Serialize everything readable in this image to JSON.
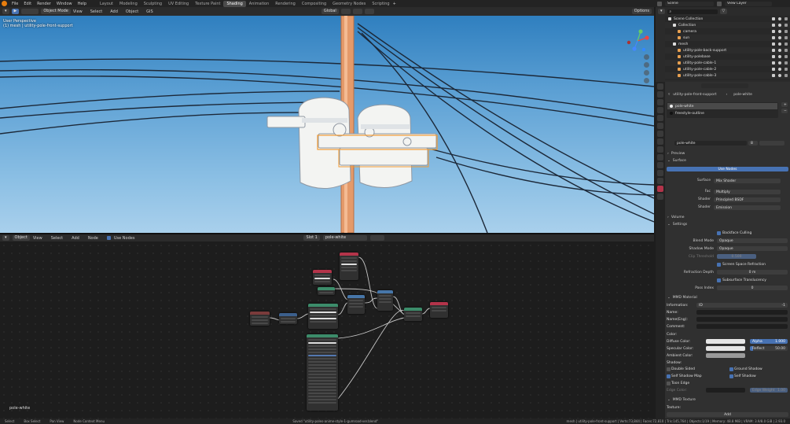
{
  "menu": {
    "items": [
      "File",
      "Edit",
      "Render",
      "Window",
      "Help"
    ]
  },
  "workspaces": [
    "Layout",
    "Modeling",
    "Sculpting",
    "UV Editing",
    "Texture Paint",
    "Shading",
    "Animation",
    "Rendering",
    "Compositing",
    "Geometry Nodes",
    "Scripting"
  ],
  "scene": {
    "name": "Scene",
    "view_layer": "View Layer"
  },
  "viewport": {
    "mode": "Object Mode",
    "menus": [
      "View",
      "Select",
      "Add",
      "Object",
      "GIS"
    ],
    "orientation": "Global",
    "options": "Options",
    "info_line1": "User Perspective",
    "info_line2": "(1) mesh | utility-pole-front-support"
  },
  "node_editor": {
    "type": "Object",
    "menus": [
      "View",
      "Select",
      "Add",
      "Node"
    ],
    "use_nodes": "Use Nodes",
    "slot": "Slot 1",
    "material": "pole-white",
    "footer_label": "pole-white"
  },
  "outliner": {
    "rows": [
      {
        "label": "Scene Collection",
        "indent": 0
      },
      {
        "label": "Collection",
        "indent": 1
      },
      {
        "label": "camera",
        "indent": 2
      },
      {
        "label": "sun",
        "indent": 2
      },
      {
        "label": "mesh",
        "indent": 1
      },
      {
        "label": "utility-pole-back-support",
        "indent": 2
      },
      {
        "label": "utility-polebase",
        "indent": 2
      },
      {
        "label": "utility-pole-cable-1",
        "indent": 2
      },
      {
        "label": "utility-pole-cable-2",
        "indent": 2
      },
      {
        "label": "utility-pole-cable-3",
        "indent": 2
      }
    ]
  },
  "properties": {
    "object": "utility-pole-front-support",
    "material": "pole-white",
    "slots": [
      "pole-white",
      "freestyle-outline"
    ],
    "material_field": "pole-white",
    "material_users": "8",
    "sections": {
      "preview": "Preview",
      "surface": "Surface",
      "volume": "Volume",
      "settings": "Settings",
      "mmd_material": "MMD Material",
      "mmd_texture": "MMD Texture"
    },
    "use_nodes_btn": "Use Nodes",
    "surface": {
      "label": "Surface",
      "value": "Mix Shader"
    },
    "fac": {
      "label": "Fac",
      "value": "Multiply"
    },
    "shader1": {
      "label": "Shader",
      "value": "Principled BSDF"
    },
    "shader2": {
      "label": "Shader",
      "value": "Emission"
    },
    "settings": {
      "backface_culling": "Backface Culling",
      "blend_mode": {
        "label": "Blend Mode",
        "value": "Opaque"
      },
      "shadow_mode": {
        "label": "Shadow Mode",
        "value": "Opaque"
      },
      "clip_threshold": {
        "label": "Clip Threshold",
        "value": "0.500"
      },
      "ssr": "Screen Space Refraction",
      "refraction_depth": {
        "label": "Refraction Depth",
        "value": "0 m"
      },
      "subsurface": "Subsurface Translucency",
      "pass_index": {
        "label": "Pass Index",
        "value": "0"
      }
    },
    "mmd": {
      "information": "Information:",
      "id_label": "ID",
      "id_value": "-1",
      "name": "Name:",
      "name_eng": "Name(Eng):",
      "comment": "Comment:",
      "color": "Color:",
      "diffuse": "Diffuse Color:",
      "alpha_label": "Alpha",
      "alpha_value": "1.000",
      "specular": "Specular Color:",
      "reflect_label": "Reflect",
      "reflect_value": "50.00",
      "ambient": "Ambient Color:",
      "shadow": "Shadow:",
      "double_sided": "Double Sided",
      "ground_shadow": "Ground Shadow",
      "self_shadow_map": "Self Shadow Map",
      "self_shadow": "Self Shadow",
      "toon_edge": "Toon Edge",
      "edge_color": "Edge Color:",
      "edge_weight": "Edge Weight",
      "edge_value": "1.00"
    },
    "mmd_texture": {
      "texture": "Texture:",
      "add": "Add"
    }
  },
  "status": {
    "select": "Select",
    "box_select": "Box Select",
    "pan_view": "Pan View",
    "node_context": "Node Context Menu",
    "saved": "Saved \"utility-poles-anime-style-1-gumroad-ver.blend\"",
    "stats": "mesh | utility-pole-front-support | Verts:73,844 | Faces:72,810 | Tris:145,764 | Objects:1/19 | Memory: 48.8 MiB | VRAM: 3.9/8.0 GiB | 2.93.0"
  },
  "colors": {
    "accent": "#4772b3",
    "blender_orange": "#e87d0d",
    "selected_tab": "#4b4b4b"
  }
}
